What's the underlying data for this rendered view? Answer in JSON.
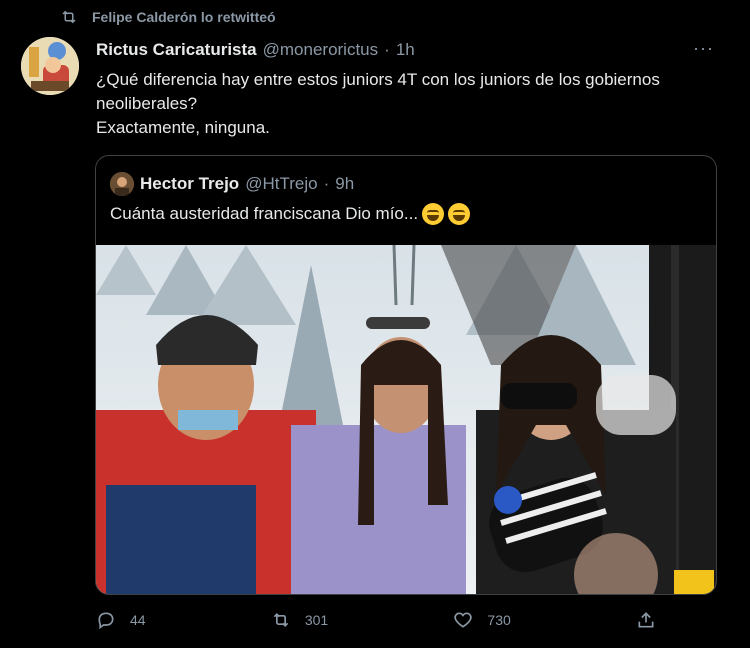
{
  "retweet": {
    "text": "Felipe Calderón lo retwitteó"
  },
  "tweet": {
    "name": "Rictus Caricaturista",
    "handle": "@monerorictus",
    "dot": "·",
    "time": "1h",
    "more": "···",
    "line1": "¿Qué diferencia hay entre estos juniors 4T con los juniors de los gobiernos neoliberales?",
    "line2": "Exactamente, ninguna."
  },
  "quote": {
    "name": "Hector Trejo",
    "handle": "@HtTrejo",
    "dot": "·",
    "time": "9h",
    "text": "Cuánta austeridad franciscana Dio mío...",
    "emojis": [
      "face-with-tears-of-joy",
      "face-with-tears-of-joy"
    ]
  },
  "actions": {
    "replies": "44",
    "retweets": "301",
    "likes": "730"
  },
  "colors": {
    "background": "#000000",
    "muted": "#8b98a5",
    "text": "#e7e9ea",
    "border": "#3e4144"
  }
}
